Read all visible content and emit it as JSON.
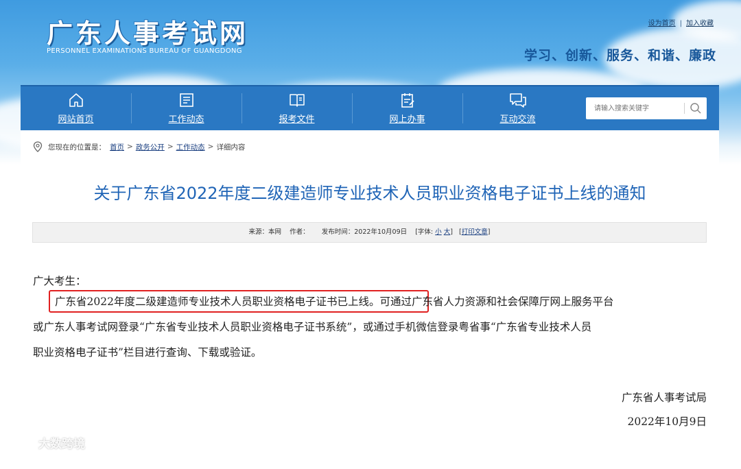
{
  "header": {
    "logo_cn": "广东人事考试网",
    "logo_en": "PERSONNEL EXAMINATIONS BUREAU OF GUANGDONG",
    "top_links": [
      "设为首页",
      "加入收藏"
    ],
    "slogan": "学习、创新、服务、和谐、廉政"
  },
  "nav": {
    "items": [
      {
        "label": "网站首页",
        "icon": "home-icon"
      },
      {
        "label": "工作动态",
        "icon": "news-icon"
      },
      {
        "label": "报考文件",
        "icon": "book-icon"
      },
      {
        "label": "网上办事",
        "icon": "clipboard-icon"
      },
      {
        "label": "互动交流",
        "icon": "chat-icon"
      }
    ],
    "search_placeholder": "请输入搜索关键字"
  },
  "breadcrumb": {
    "prefix": "您现在的位置是：",
    "links": [
      "首页",
      "政务公开",
      "工作动态"
    ],
    "current": "详细内容"
  },
  "article": {
    "title": "关于广东省2022年度二级建造师专业技术人员职业资格电子证书上线的通知",
    "meta": {
      "source": "来源：本网",
      "author": "作者：",
      "date": "发布时间：2022年10月09日",
      "font_label": "[字体:",
      "font_small": "小",
      "font_large": "大",
      "font_close": "]",
      "print_open": "[",
      "print": "打印文章",
      "print_close": "]"
    },
    "salutation": "广大考生：",
    "highlight": "广东省2022年度二级建造师专业技术人员职业资格电子证书已上线。",
    "line1_rest": "可通过广东省人力资源和社会保障厅网上服务平台",
    "line2": "或广东人事考试网登录“广东省专业技术人员职业资格电子证书系统”，或通过手机微信登录粤省事“广东省专业技术人员",
    "line3": "职业资格电子证书”栏目进行查询、下载或验证。",
    "sign_org": "广东省人事考试局",
    "sign_date": "2022年10月9日"
  },
  "watermark": "大数跨境",
  "colors": {
    "nav_bg": "#2a78c3",
    "title": "#1f64b6",
    "slogan": "#17579a",
    "highlight_border": "#e02020"
  }
}
